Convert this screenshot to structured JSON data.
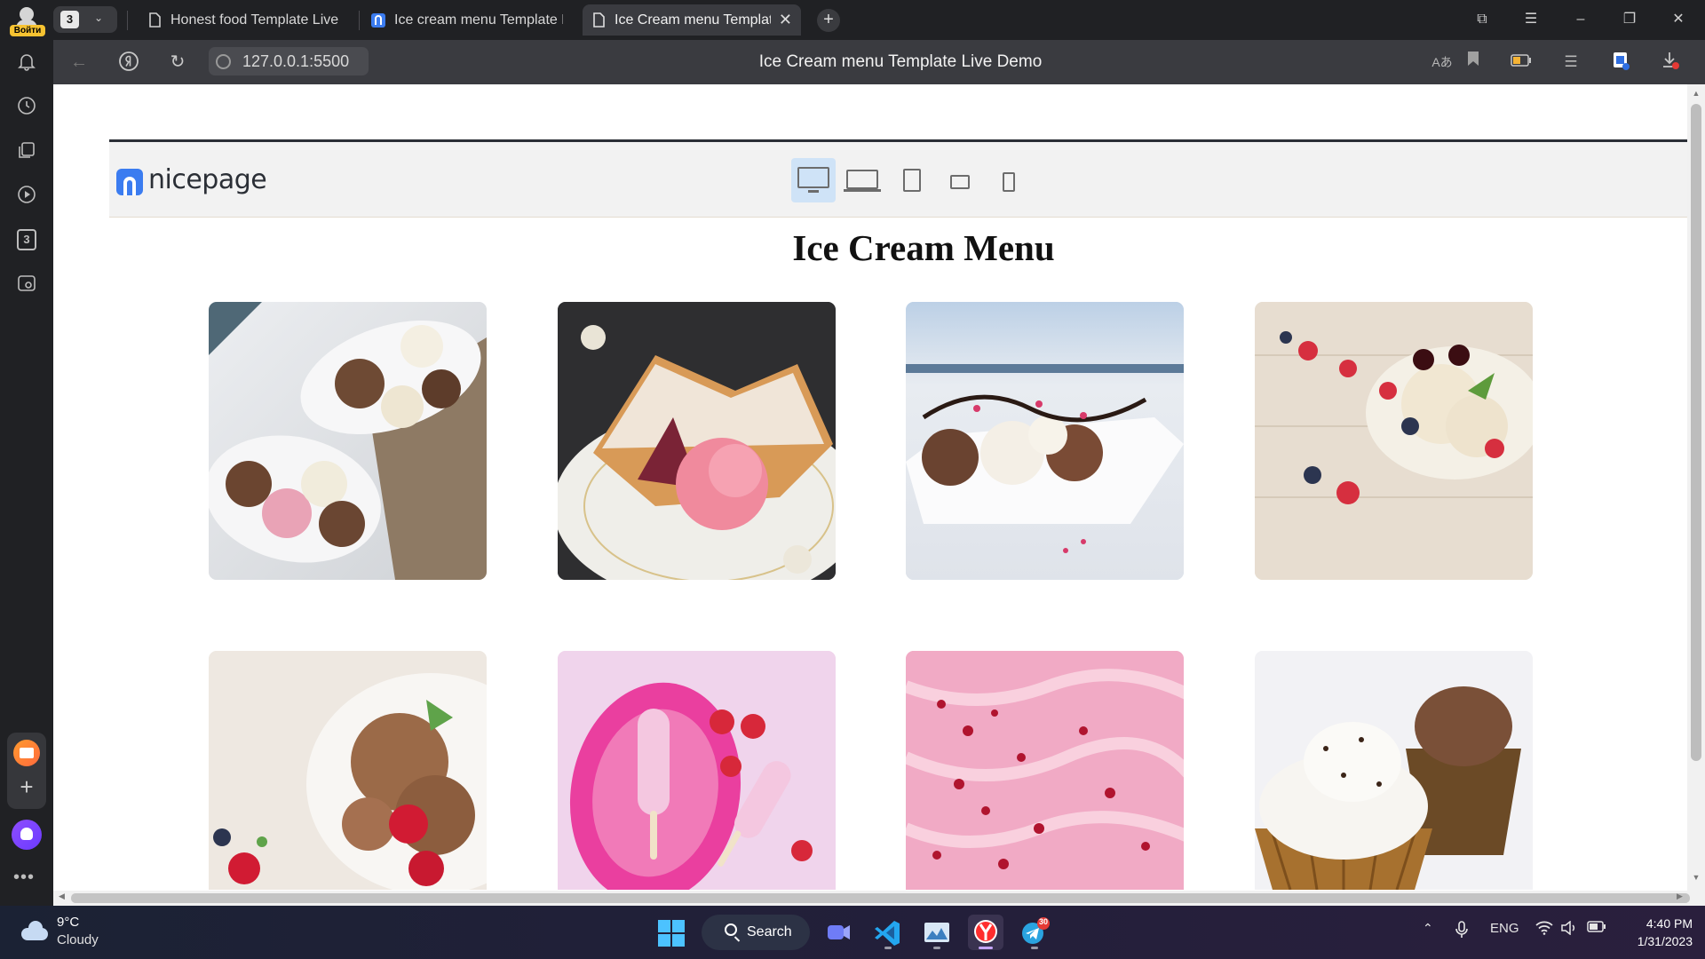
{
  "browser": {
    "profile": {
      "login_label": "Войти"
    },
    "tab_count": "3",
    "tabs": [
      {
        "title": "Honest food Template Live Demo",
        "active": false
      },
      {
        "title": "Ice cream menu Template Live Demo",
        "active": false
      },
      {
        "title": "Ice Cream menu Template Live Demo",
        "active": true
      }
    ],
    "new_tab": "+",
    "url": "127.0.0.1:5500",
    "page_title": "Ice Cream menu Template Live Demo",
    "sidebar_tab_count": "3"
  },
  "page": {
    "logo_text": "nicepage",
    "devices": [
      "desktop",
      "laptop",
      "tablet",
      "tablet-landscape",
      "phone"
    ],
    "selected_device": "desktop",
    "heading": "Ice Cream Menu",
    "tiles": [
      {
        "subject": "scoops in white bowls on marble"
      },
      {
        "subject": "strudel with pink ice cream"
      },
      {
        "subject": "sundae with chocolate in white dish"
      },
      {
        "subject": "ice cream with cherries and berries"
      },
      {
        "subject": "chocolate ice cream with raspberries"
      },
      {
        "subject": "pink popsicles with strawberries"
      },
      {
        "subject": "pink ice cream with red sprinkles"
      },
      {
        "subject": "ice cream in waffle cups"
      }
    ]
  },
  "taskbar": {
    "temperature": "9°C",
    "condition": "Cloudy",
    "search_label": "Search",
    "telegram_badge": "30",
    "language": "ENG",
    "time": "4:40 PM",
    "date": "1/31/2023"
  },
  "colors": {
    "accent_blue": "#3b7cf0",
    "device_selected": "#cfe3f7",
    "yandex_red": "#ff2e2e",
    "windows_blue": "#4cc2ff"
  }
}
